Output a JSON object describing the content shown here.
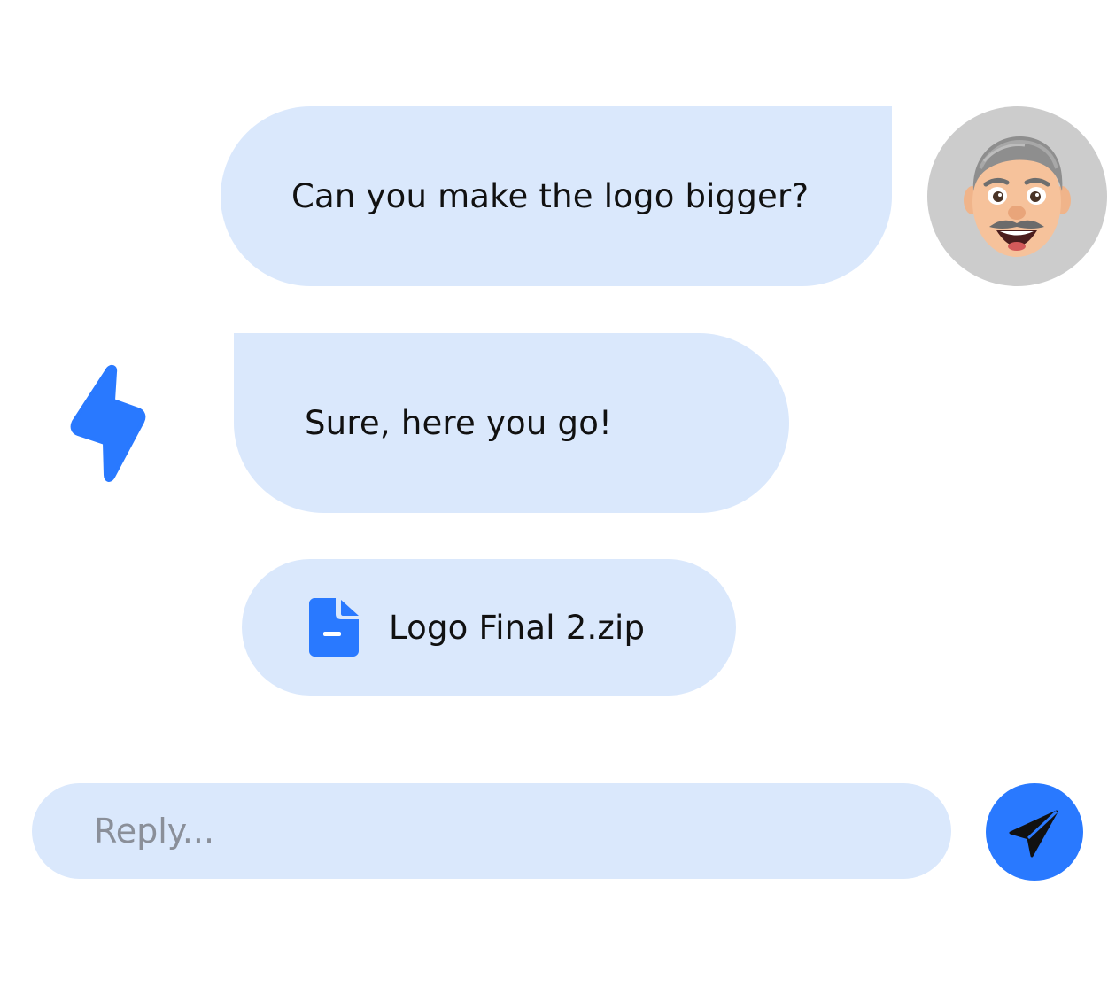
{
  "messages": {
    "user_message": "Can you make the logo bigger?",
    "bot_message": "Sure, here you go!",
    "attachment_name": "Logo Final 2.zip"
  },
  "reply": {
    "placeholder": "Reply..."
  },
  "icons": {
    "avatar": "user-avatar",
    "bot": "lightning-bolt-icon",
    "file": "file-icon",
    "send": "paper-plane-icon"
  },
  "colors": {
    "bubble": "#dae8fc",
    "accent": "#2979ff",
    "avatar_bg": "#cccccc"
  }
}
